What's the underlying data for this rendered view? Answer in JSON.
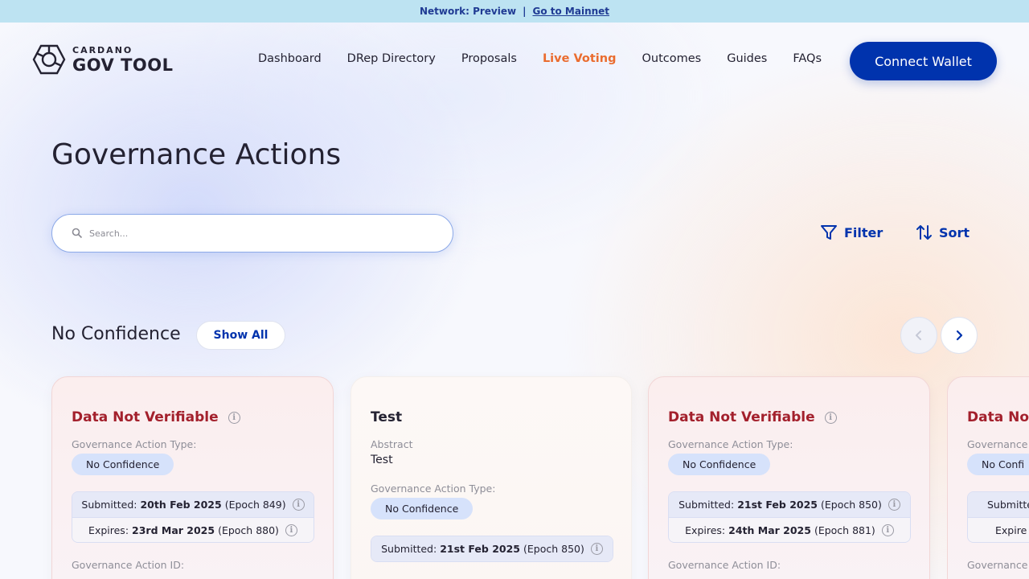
{
  "banner": {
    "network_label": "Network: Preview",
    "separator": "|",
    "mainnet_link": "Go to Mainnet"
  },
  "logo": {
    "small": "CARDANO",
    "big": "GOV TOOL"
  },
  "nav": {
    "items": [
      {
        "label": "Dashboard",
        "active": false
      },
      {
        "label": "DRep Directory",
        "active": false
      },
      {
        "label": "Proposals",
        "active": false
      },
      {
        "label": "Live Voting",
        "active": true
      },
      {
        "label": "Outcomes",
        "active": false
      },
      {
        "label": "Guides",
        "active": false
      },
      {
        "label": "FAQs",
        "active": false
      }
    ],
    "connect_label": "Connect Wallet"
  },
  "page": {
    "title": "Governance Actions"
  },
  "search": {
    "placeholder": "Search..."
  },
  "toolbar": {
    "filter_label": "Filter",
    "sort_label": "Sort"
  },
  "section": {
    "title": "No Confidence",
    "show_all_label": "Show All"
  },
  "cards": [
    {
      "title": "Data Not Verifiable",
      "type_label": "Governance Action Type:",
      "type_value": "No Confidence",
      "submitted_label": "Submitted:",
      "submitted_date": "20th Feb 2025",
      "submitted_epoch": "(Epoch 849)",
      "expires_label": "Expires:",
      "expires_date": "23rd Mar 2025",
      "expires_epoch": "(Epoch 880)",
      "id_label": "Governance Action ID:"
    },
    {
      "title": "Test",
      "abstract_label": "Abstract",
      "abstract_value": "Test",
      "type_label": "Governance Action Type:",
      "type_value": "No Confidence",
      "submitted_label": "Submitted:",
      "submitted_date": "21st Feb 2025",
      "submitted_epoch": "(Epoch 850)"
    },
    {
      "title": "Data Not Verifiable",
      "type_label": "Governance Action Type:",
      "type_value": "No Confidence",
      "submitted_label": "Submitted:",
      "submitted_date": "21st Feb 2025",
      "submitted_epoch": "(Epoch 850)",
      "expires_label": "Expires:",
      "expires_date": "24th Mar 2025",
      "expires_epoch": "(Epoch 881)",
      "id_label": "Governance Action ID:"
    },
    {
      "title": "Data Not Verifiable",
      "type_label": "Governance",
      "type_value": "No Confi",
      "submitted_label": "Submitte",
      "expires_label": "Expire",
      "id_label": "Governance"
    }
  ],
  "colors": {
    "primary": "#0033ad",
    "active_nav": "#ea6c2f",
    "warning": "#a3202c",
    "chip": "#d6e2fb"
  }
}
